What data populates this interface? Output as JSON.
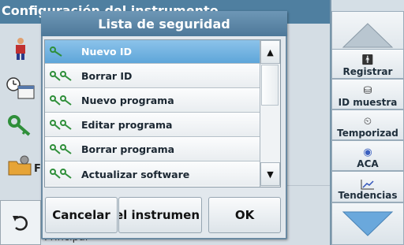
{
  "background": {
    "title": "Configuración del instrumento",
    "footer_label": "Principal",
    "partial_f": "F"
  },
  "sidebar": {
    "registrar": "Registrar",
    "id_muestra": "ID muestra",
    "temporizad": "Temporizad",
    "aca": "ACA",
    "tendencias": "Tendencias"
  },
  "dialog": {
    "title": "Lista de seguridad",
    "items": [
      {
        "label": "Nuevo ID",
        "icon": "single-key-icon",
        "selected": true
      },
      {
        "label": "Borrar ID",
        "icon": "double-key-icon",
        "selected": false
      },
      {
        "label": "Nuevo programa",
        "icon": "double-key-icon",
        "selected": false
      },
      {
        "label": "Editar programa",
        "icon": "double-key-icon",
        "selected": false
      },
      {
        "label": "Borrar programa",
        "icon": "double-key-icon",
        "selected": false
      },
      {
        "label": "Actualizar software",
        "icon": "double-key-icon",
        "selected": false
      }
    ],
    "cancel": "Cancelar",
    "middle": "el instrumen",
    "ok": "OK"
  },
  "colors": {
    "title_bar": "#4f7fa0",
    "selected_row": "#6aaede",
    "key_green": "#2f8f3a"
  }
}
